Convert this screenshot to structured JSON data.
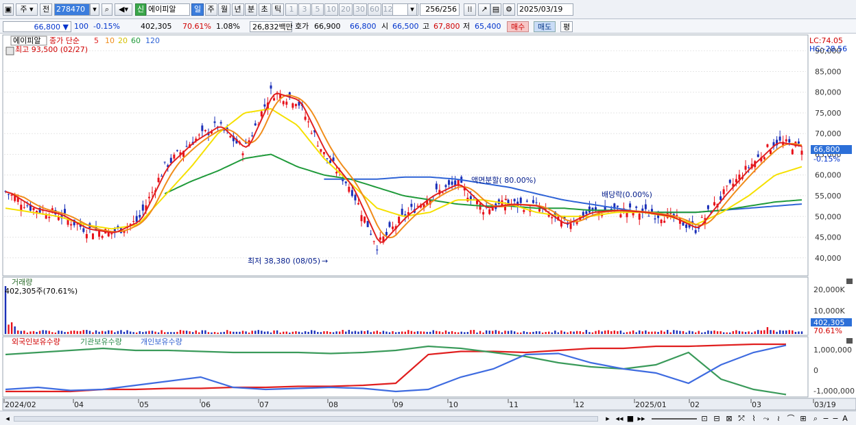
{
  "toolbar": {
    "period_main": "주",
    "prev_label": "전",
    "code": "278470",
    "badge": "신",
    "stock_name": "에이피알",
    "periods": [
      "일",
      "주",
      "월",
      "년",
      "분",
      "초",
      "틱"
    ],
    "active_period": "일",
    "intervals": [
      "1",
      "3",
      "5",
      "10",
      "20",
      "30",
      "60",
      "120"
    ],
    "count": "256",
    "count_total": "/256",
    "date": "2025/03/19"
  },
  "info": {
    "price": "66,800",
    "change_arrow": "▼",
    "change": "100",
    "change_pct": "-0.15%",
    "volume": "402,305",
    "volume_ratio": "70.61%",
    "turnover_rate": "1.08%",
    "amount": "26,832백만",
    "quote_label": "호가",
    "ask": "66,900",
    "bid": "66,800",
    "open_label": "시",
    "open": "66,500",
    "high_label": "고",
    "high": "67,800",
    "low_label": "저",
    "low": "65,400",
    "buy_label": "매수",
    "sell_label": "매도",
    "avg_label": "평"
  },
  "price_panel": {
    "name_box": "에이피알",
    "legend_head": "종가 단순",
    "ma_labels": [
      "5",
      "10",
      "20",
      "60",
      "120"
    ],
    "high_annot": "최고 93,500 (02/27)",
    "low_annot": "최저 38,380 (08/05)",
    "split_annot": "액면분할( 80.00%)",
    "dividend_annot": "배당락(0.00%)",
    "lc": "LC:74.05",
    "hc": "HC:-28.56",
    "last_price_box": "66,800",
    "last_change": "-0.15%"
  },
  "volume_panel": {
    "title": "거래량",
    "value": "402,305주(70.61%)",
    "last_box": "402,305",
    "last_ratio": "70.61%"
  },
  "holding_panel": {
    "series": [
      "외국인보유수량",
      "기관보유수량",
      "개인보유수량"
    ]
  },
  "x_axis_labels": [
    "2024/02",
    "04",
    "05",
    "06",
    "07",
    "08",
    "09",
    "10",
    "11",
    "12",
    "2025/01",
    "02",
    "03",
    "03/19"
  ],
  "colors": {
    "up": "#e8101a",
    "down": "#1a2fb8",
    "ma5": "#e02020",
    "ma10": "#f08c1a",
    "ma20": "#f5e000",
    "ma60": "#1f9a3a",
    "ma120": "#2e63d6",
    "foreign": "#e01e1e",
    "institution": "#3a9a5a",
    "individual": "#3e6be0"
  },
  "chart_data": [
    {
      "type": "candlestick",
      "title": "에이피알",
      "y_ticks": [
        90000,
        85000,
        80000,
        75000,
        70000,
        65000,
        60000,
        55000,
        50000,
        45000,
        40000
      ],
      "y_tick_labels": [
        "90,000",
        "85,000",
        "80,000",
        "75,000",
        "70,000",
        "65,000",
        "60,000",
        "55,000",
        "50,000",
        "45,000",
        "40,000"
      ],
      "ylim": [
        36000,
        93500
      ],
      "x": [
        "2024/02",
        "04",
        "05",
        "06",
        "07",
        "08",
        "09",
        "10",
        "11",
        "12",
        "2025/01",
        "02",
        "03"
      ],
      "close": [
        56000,
        52000,
        50500,
        47000,
        46000,
        49000,
        62000,
        68000,
        72000,
        66000,
        80000,
        78000,
        65000,
        57000,
        43000,
        50000,
        55000,
        58000,
        52000,
        53000,
        52500,
        48000,
        51000,
        51500,
        51000,
        50000,
        47000,
        55000,
        62000,
        68000,
        66800
      ],
      "ma20": [
        52000,
        51000,
        50000,
        48000,
        47000,
        48000,
        55000,
        62000,
        70000,
        75000,
        76000,
        72000,
        64000,
        58000,
        52000,
        50000,
        51000,
        54000,
        54000,
        53000,
        51000,
        50000,
        50000,
        51000,
        51000,
        50000,
        48000,
        51000,
        55000,
        60000,
        62000
      ],
      "ma60": [
        null,
        null,
        null,
        null,
        null,
        null,
        55500,
        58500,
        61000,
        64000,
        65000,
        62000,
        60000,
        59000,
        57000,
        55000,
        54000,
        53000,
        52500,
        52500,
        52000,
        52000,
        51500,
        51500,
        51000,
        51000,
        51000,
        51500,
        52500,
        53500,
        54000
      ],
      "ma120": [
        null,
        null,
        null,
        null,
        null,
        null,
        null,
        null,
        null,
        null,
        null,
        null,
        59000,
        59000,
        59000,
        59500,
        59500,
        59000,
        58000,
        57000,
        55500,
        54000,
        53000,
        52000,
        51000,
        51000,
        51000,
        51500,
        52000,
        52500,
        53000
      ],
      "annotations": [
        "최고 93,500 (02/27)",
        "최저 38,380 (08/05)",
        "액면분할( 80.00%)",
        "배당락(0.00%)"
      ]
    },
    {
      "type": "bar",
      "title": "거래량",
      "y_tick_labels": [
        "20,000K",
        "10,000K"
      ],
      "last": "402,305"
    },
    {
      "type": "line",
      "series": [
        {
          "name": "외국인보유수량",
          "values": [
            -1100000,
            -1100000,
            -1100000,
            -1000000,
            -1000000,
            -950000,
            -950000,
            -900000,
            -900000,
            -850000,
            -850000,
            -800000,
            -700000,
            700000,
            850000,
            850000,
            800000,
            900000,
            1000000,
            1000000,
            1100000,
            1100000,
            1150000,
            1200000,
            1200000
          ]
        },
        {
          "name": "기관보유수량",
          "values": [
            700000,
            800000,
            900000,
            1000000,
            900000,
            900000,
            850000,
            800000,
            800000,
            800000,
            750000,
            800000,
            900000,
            1100000,
            1000000,
            800000,
            600000,
            300000,
            100000,
            0,
            200000,
            800000,
            -500000,
            -1000000,
            -1250000
          ]
        },
        {
          "name": "개인보유수량",
          "values": [
            -1000000,
            -900000,
            -1050000,
            -1000000,
            -800000,
            -600000,
            -400000,
            -900000,
            -1000000,
            -950000,
            -900000,
            -950000,
            -1100000,
            -1000000,
            -400000,
            0,
            700000,
            750000,
            300000,
            0,
            -200000,
            -700000,
            200000,
            800000,
            1150000
          ]
        }
      ],
      "y_tick_labels": [
        "1,000,000",
        "0",
        "-1,000,000"
      ]
    }
  ]
}
